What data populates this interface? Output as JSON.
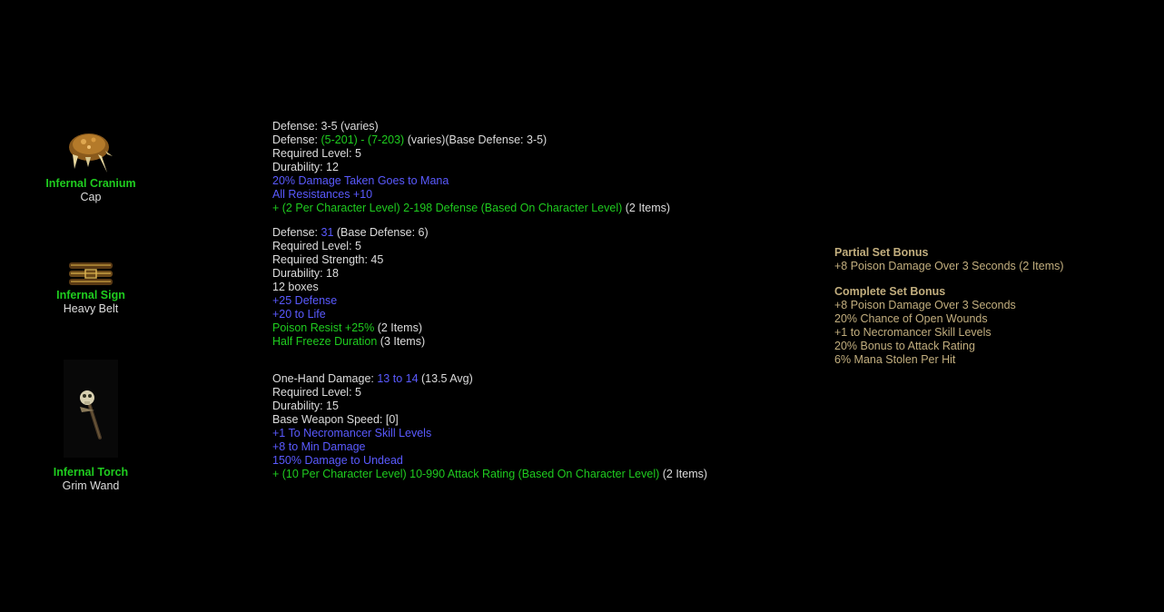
{
  "items": [
    {
      "name": "Infernal Cranium",
      "base": "Cap",
      "icon": "cranium-cap-icon",
      "stats": [
        [
          {
            "t": "Defense: 3-5 (varies)",
            "c": "white"
          }
        ],
        [
          {
            "t": "Defense: ",
            "c": "white"
          },
          {
            "t": "(5-201) - (7-203)",
            "c": "green"
          },
          {
            "t": " (varies)(Base Defense: 3-5)",
            "c": "white"
          }
        ],
        [
          {
            "t": "Required Level: 5",
            "c": "white"
          }
        ],
        [
          {
            "t": "Durability: 12",
            "c": "white"
          }
        ],
        [
          {
            "t": "20% Damage Taken Goes to Mana",
            "c": "blue"
          }
        ],
        [
          {
            "t": "All Resistances +10",
            "c": "blue"
          }
        ],
        [
          {
            "t": "+ (2 Per Character Level) 2-198 Defense (Based On Character Level)",
            "c": "green"
          },
          {
            "t": " (2 Items)",
            "c": "white"
          }
        ]
      ]
    },
    {
      "name": "Infernal Sign",
      "base": "Heavy Belt",
      "icon": "heavy-belt-icon",
      "stats": [
        [
          {
            "t": "Defense: ",
            "c": "white"
          },
          {
            "t": "31",
            "c": "blue"
          },
          {
            "t": " (Base Defense: 6)",
            "c": "white"
          }
        ],
        [
          {
            "t": "Required Level: 5",
            "c": "white"
          }
        ],
        [
          {
            "t": "Required Strength: 45",
            "c": "white"
          }
        ],
        [
          {
            "t": "Durability: 18",
            "c": "white"
          }
        ],
        [
          {
            "t": "12 boxes",
            "c": "white"
          }
        ],
        [
          {
            "t": "+25 Defense",
            "c": "blue"
          }
        ],
        [
          {
            "t": "+20 to Life",
            "c": "blue"
          }
        ],
        [
          {
            "t": "Poison Resist +25%",
            "c": "green"
          },
          {
            "t": " (2 Items)",
            "c": "white"
          }
        ],
        [
          {
            "t": "Half Freeze Duration",
            "c": "green"
          },
          {
            "t": " (3 Items)",
            "c": "white"
          }
        ]
      ]
    },
    {
      "name": "Infernal Torch",
      "base": "Grim Wand",
      "icon": "grim-wand-icon",
      "stats": [
        [
          {
            "t": "One-Hand Damage: ",
            "c": "white"
          },
          {
            "t": "13 to 14",
            "c": "blue"
          },
          {
            "t": " (13.5 Avg)",
            "c": "white"
          }
        ],
        [
          {
            "t": "Required Level: 5",
            "c": "white"
          }
        ],
        [
          {
            "t": "Durability: 15",
            "c": "white"
          }
        ],
        [
          {
            "t": "Base Weapon Speed: [0]",
            "c": "white"
          }
        ],
        [
          {
            "t": "+1 To Necromancer Skill Levels",
            "c": "blue"
          }
        ],
        [
          {
            "t": "+8 to Min Damage",
            "c": "blue"
          }
        ],
        [
          {
            "t": "150% Damage to Undead",
            "c": "blue"
          }
        ],
        [
          {
            "t": "+ (10 Per Character Level) 10-990 Attack Rating (Based On Character Level)",
            "c": "green"
          },
          {
            "t": " (2 Items)",
            "c": "white"
          }
        ]
      ]
    }
  ],
  "set_bonus": {
    "partial_title": "Partial Set Bonus",
    "partial": [
      "+8 Poison Damage Over 3 Seconds (2 Items)"
    ],
    "complete_title": "Complete Set Bonus",
    "complete": [
      "+8 Poison Damage Over 3 Seconds",
      "20% Chance of Open Wounds",
      "+1 to Necromancer Skill Levels",
      "20% Bonus to Attack Rating",
      "6% Mana Stolen Per Hit"
    ]
  }
}
